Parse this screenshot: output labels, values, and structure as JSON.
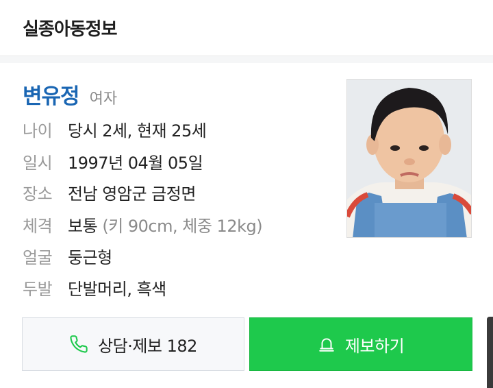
{
  "header": {
    "title": "실종아동정보"
  },
  "person": {
    "name": "변유정",
    "gender": "여자",
    "details": [
      {
        "label": "나이",
        "value": "당시 2세, 현재 25세",
        "sub": ""
      },
      {
        "label": "일시",
        "value": "1997년 04월 05일",
        "sub": ""
      },
      {
        "label": "장소",
        "value": "전남 영암군 금정면",
        "sub": ""
      },
      {
        "label": "체격",
        "value": "보통",
        "sub": "(키 90cm, 체중 12kg)"
      },
      {
        "label": "얼굴",
        "value": "둥근형",
        "sub": ""
      },
      {
        "label": "두발",
        "value": "단발머리, 흑색",
        "sub": ""
      }
    ]
  },
  "actions": {
    "call_label": "상담·제보 182",
    "call_icon": "phone-icon",
    "report_label": "제보하기",
    "report_icon": "siren-icon"
  },
  "colors": {
    "name": "#1a66b3",
    "report_button": "#1ec94c",
    "phone_icon": "#1ec94c"
  }
}
